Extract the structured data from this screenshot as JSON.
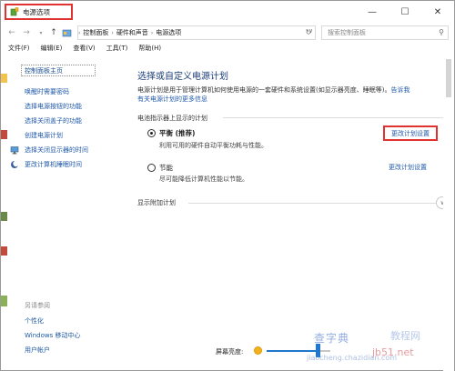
{
  "window": {
    "title": "电源选项",
    "controls": {
      "minimize": "—",
      "maximize": "☐",
      "close": "✕"
    }
  },
  "nav": {
    "back": "←",
    "forward": "→",
    "up": "↑",
    "breadcrumb": [
      "控制面板",
      "硬件和声音",
      "电源选项"
    ],
    "refresh": "↻",
    "search_placeholder": "搜索控制面板"
  },
  "menu": [
    "文件(F)",
    "编辑(E)",
    "查看(V)",
    "工具(T)",
    "帮助(H)"
  ],
  "sidebar": {
    "home": "控制面板主页",
    "links": [
      "唤醒时需要密码",
      "选择电源按钮的功能",
      "选择关闭盖子的功能",
      "创建电源计划",
      "选择关闭显示器的时间",
      "更改计算机睡眠时间"
    ],
    "see_also_title": "另请参阅",
    "see_also": [
      "个性化",
      "Windows 移动中心",
      "用户帐户"
    ]
  },
  "main": {
    "heading": "选择或自定义电源计划",
    "description_1": "电源计划是用于管理计算机如何使用电源的一套硬件和系统设置(如显示器亮度、睡眠等)。",
    "description_link_1": "告诉我",
    "description_link_2": "有关电源计划的更多信息",
    "section_title": "电池指示器上显示的计划",
    "plans": [
      {
        "name": "平衡 (推荐)",
        "desc": "利用可用的硬件自动平衡功耗与性能。",
        "selected": true,
        "change_label": "更改计划设置"
      },
      {
        "name": "节能",
        "desc": "尽可能降低计算机性能以节能。",
        "selected": false,
        "change_label": "更改计划设置"
      }
    ],
    "more_plans": "显示附加计划",
    "expand_icon": "chevron-down-icon"
  },
  "brightness": {
    "label": "屏幕亮度:",
    "level_percent": 80
  },
  "watermark": {
    "text_1": "查字典",
    "text_2": "教程网",
    "text_3": "jiaocheng.chazidian.com",
    "text_4": "jb51.net"
  },
  "colors": {
    "highlight_red": "#e0332f",
    "link_blue": "#1f58a8",
    "heading_blue": "#1e3f77",
    "slider_blue": "#1f77d0"
  }
}
